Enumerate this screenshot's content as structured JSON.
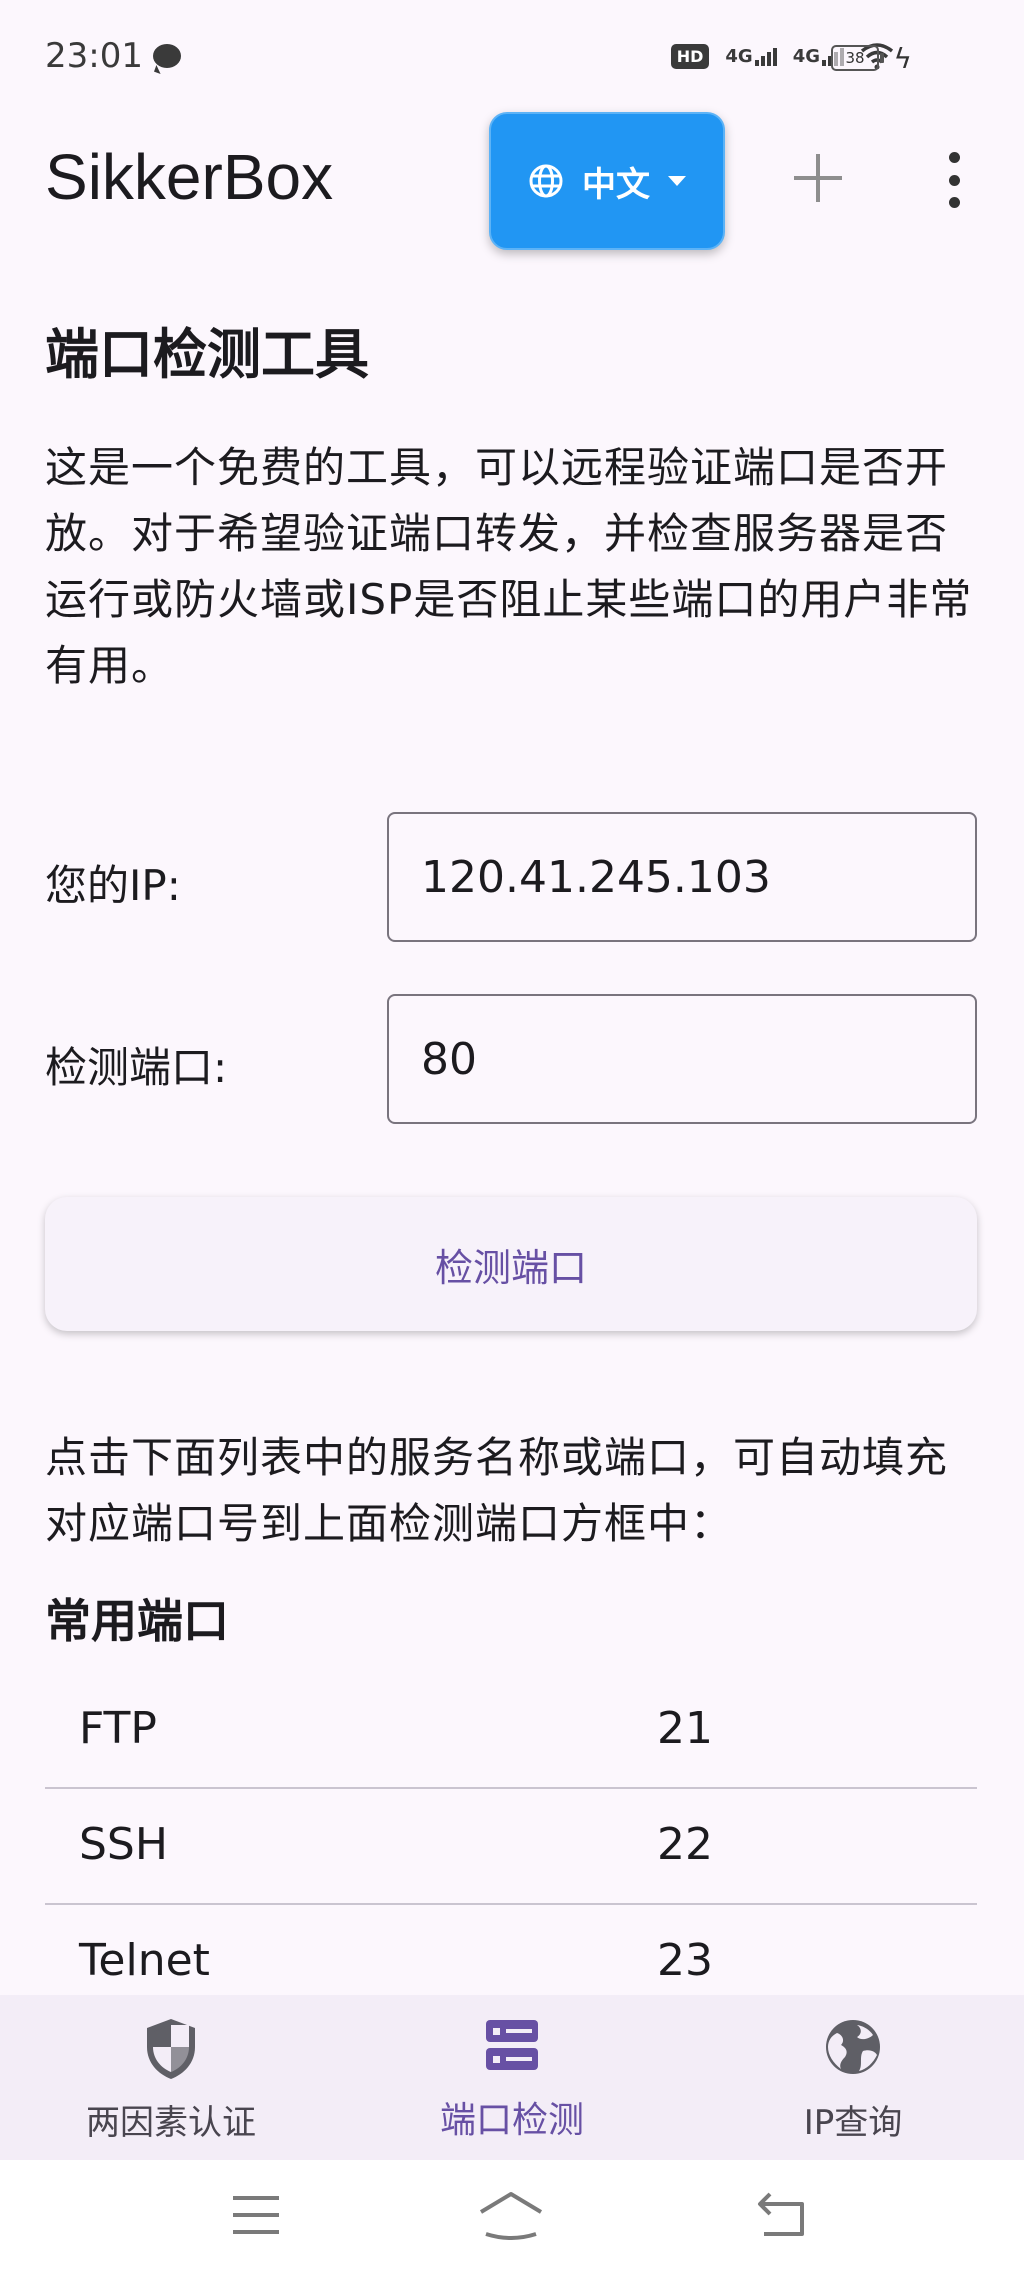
{
  "status_bar": {
    "time": "23:01",
    "network_1": "4G",
    "network_2": "4G",
    "hd": "HD",
    "battery": "38"
  },
  "app_bar": {
    "title": "SikkerBox",
    "language_label": "中文",
    "language_icon": "globe-icon",
    "add_icon": "plus-icon",
    "more_icon": "more-vertical-icon"
  },
  "content": {
    "heading": "端口检测工具",
    "description": "这是一个免费的工具，可以远程验证端口是否开放。对于希望验证端口转发，并检查服务器是否运行或防火墙或ISP是否阻止某些端口的用户非常有用。",
    "ip_label": "您的IP:",
    "ip_value": "120.41.245.103",
    "port_label": "检测端口:",
    "port_value": "80",
    "check_button": "检测端口",
    "hint": "点击下面列表中的服务名称或端口，可自动填充对应端口号到上面检测端口方框中：",
    "common_ports_heading": "常用端口",
    "ports": [
      {
        "service": "FTP",
        "port": "21"
      },
      {
        "service": "SSH",
        "port": "22"
      },
      {
        "service": "Telnet",
        "port": "23"
      }
    ]
  },
  "bottom_nav": {
    "items": [
      {
        "label": "两因素认证",
        "icon": "shield-icon"
      },
      {
        "label": "端口检测",
        "icon": "server-icon"
      },
      {
        "label": "IP查询",
        "icon": "globe-icon"
      }
    ],
    "active_index": 1
  },
  "system_nav": {
    "menu_icon": "menu-icon",
    "home_icon": "home-icon",
    "back_icon": "back-icon"
  },
  "colors": {
    "primary": "#6750a4",
    "language_button": "#2196f3",
    "background": "#fcf7fd"
  }
}
